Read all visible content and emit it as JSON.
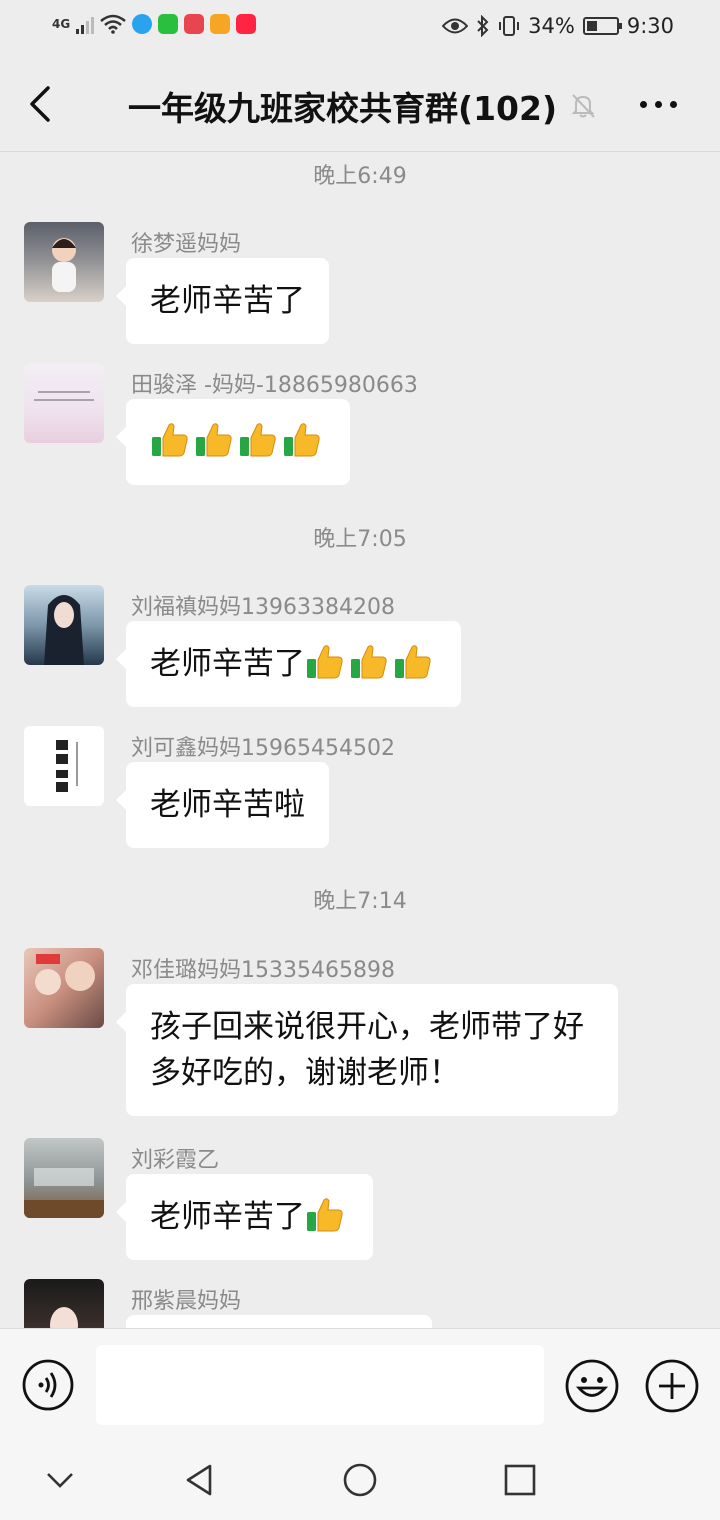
{
  "status_bar": {
    "network": "4G",
    "battery_text": "34%",
    "battery_level": 0.34,
    "time": "9:30",
    "app_icons": [
      {
        "name": "qq-browser-icon",
        "color": "#2aa3ef"
      },
      {
        "name": "iqiyi-icon",
        "color": "#2bbf3f"
      },
      {
        "name": "weibo-app-icon",
        "color": "#e9454f"
      },
      {
        "name": "notes-app-icon",
        "color": "#f6a623"
      },
      {
        "name": "xiaohongshu-icon",
        "color": "#ff2442"
      }
    ]
  },
  "header": {
    "title": "一年级九班家校共育群(102)"
  },
  "chat": {
    "timestamps": [
      "晚上6:49",
      "晚上7:05",
      "晚上7:14"
    ],
    "messages": [
      {
        "sender": "徐梦遥妈妈",
        "text": "老师辛苦了",
        "thumbs": 0
      },
      {
        "sender": "田骏泽 -妈妈-18865980663",
        "text": "",
        "thumbs": 4
      },
      {
        "sender": "刘福禛妈妈13963384208",
        "text": "老师辛苦了",
        "thumbs": 3
      },
      {
        "sender": "刘可鑫妈妈15965454502",
        "text": "老师辛苦啦",
        "thumbs": 0
      },
      {
        "sender": "邓佳璐妈妈15335465898",
        "text": "孩子回来说很开心，老师带了好多好吃的，谢谢老师！",
        "thumbs": 0
      },
      {
        "sender": "刘彩霞乙",
        "text": "老师辛苦了",
        "thumbs": 1
      },
      {
        "sender": "邢紫晨妈妈",
        "text": "",
        "thumbs": 0
      }
    ]
  },
  "input_bar": {
    "placeholder": ""
  },
  "colors": {
    "background": "#ededed",
    "bubble": "#ffffff",
    "meta_text": "#8a8a8a"
  }
}
